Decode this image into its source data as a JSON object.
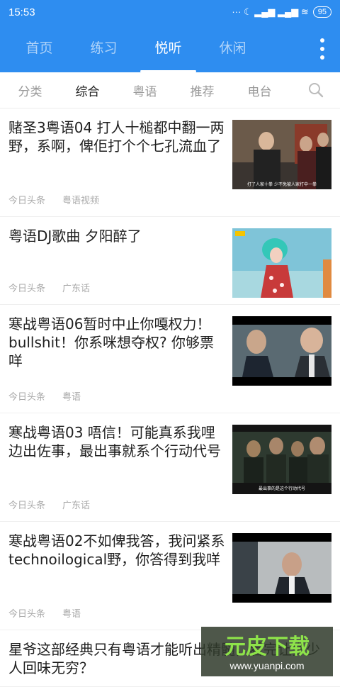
{
  "status": {
    "time": "15:53",
    "icons": "··· ☾ ▂▄▆ ▂▄▆ ≋",
    "battery": "95"
  },
  "tabs": [
    "首页",
    "练习",
    "悦听",
    "休闲"
  ],
  "subtabs": [
    "分类",
    "综合",
    "粤语",
    "推荐",
    "电台"
  ],
  "items": [
    {
      "title": "赌圣3粤语04 打人十槌都中翻一两野，系啊，俾佢打个个七孔流血了",
      "source": "今日头条",
      "tag": "粤语视频",
      "caption": "打了人家十拳 少不免被人家打中一拳"
    },
    {
      "title": "粤语DJ歌曲  夕阳醉了",
      "source": "今日头条",
      "tag": "广东话",
      "caption": ""
    },
    {
      "title": "寒战粤语06暂时中止你嘎权力！bullshit！你系咪想夺权? 你够票咩",
      "source": "今日头条",
      "tag": "粤语",
      "caption": ""
    },
    {
      "title": "寒战粤语03 唔信！可能真系我哩边出佐事，最出事就系个行动代号",
      "source": "今日头条",
      "tag": "广东话",
      "caption": "最出事的是这个行动代号"
    },
    {
      "title": "寒战粤语02不如俾我答，我问紧系technoilogical野，你答得到我咩",
      "source": "今日头条",
      "tag": "粤语",
      "caption": ""
    },
    {
      "title": "星爷这部经典只有粤语才能听出精髓，看完让多少人回味无穷？",
      "source": "",
      "tag": "",
      "caption": ""
    }
  ],
  "watermark": {
    "brand": "元皮下载",
    "url": "www.yuanpi.com"
  }
}
